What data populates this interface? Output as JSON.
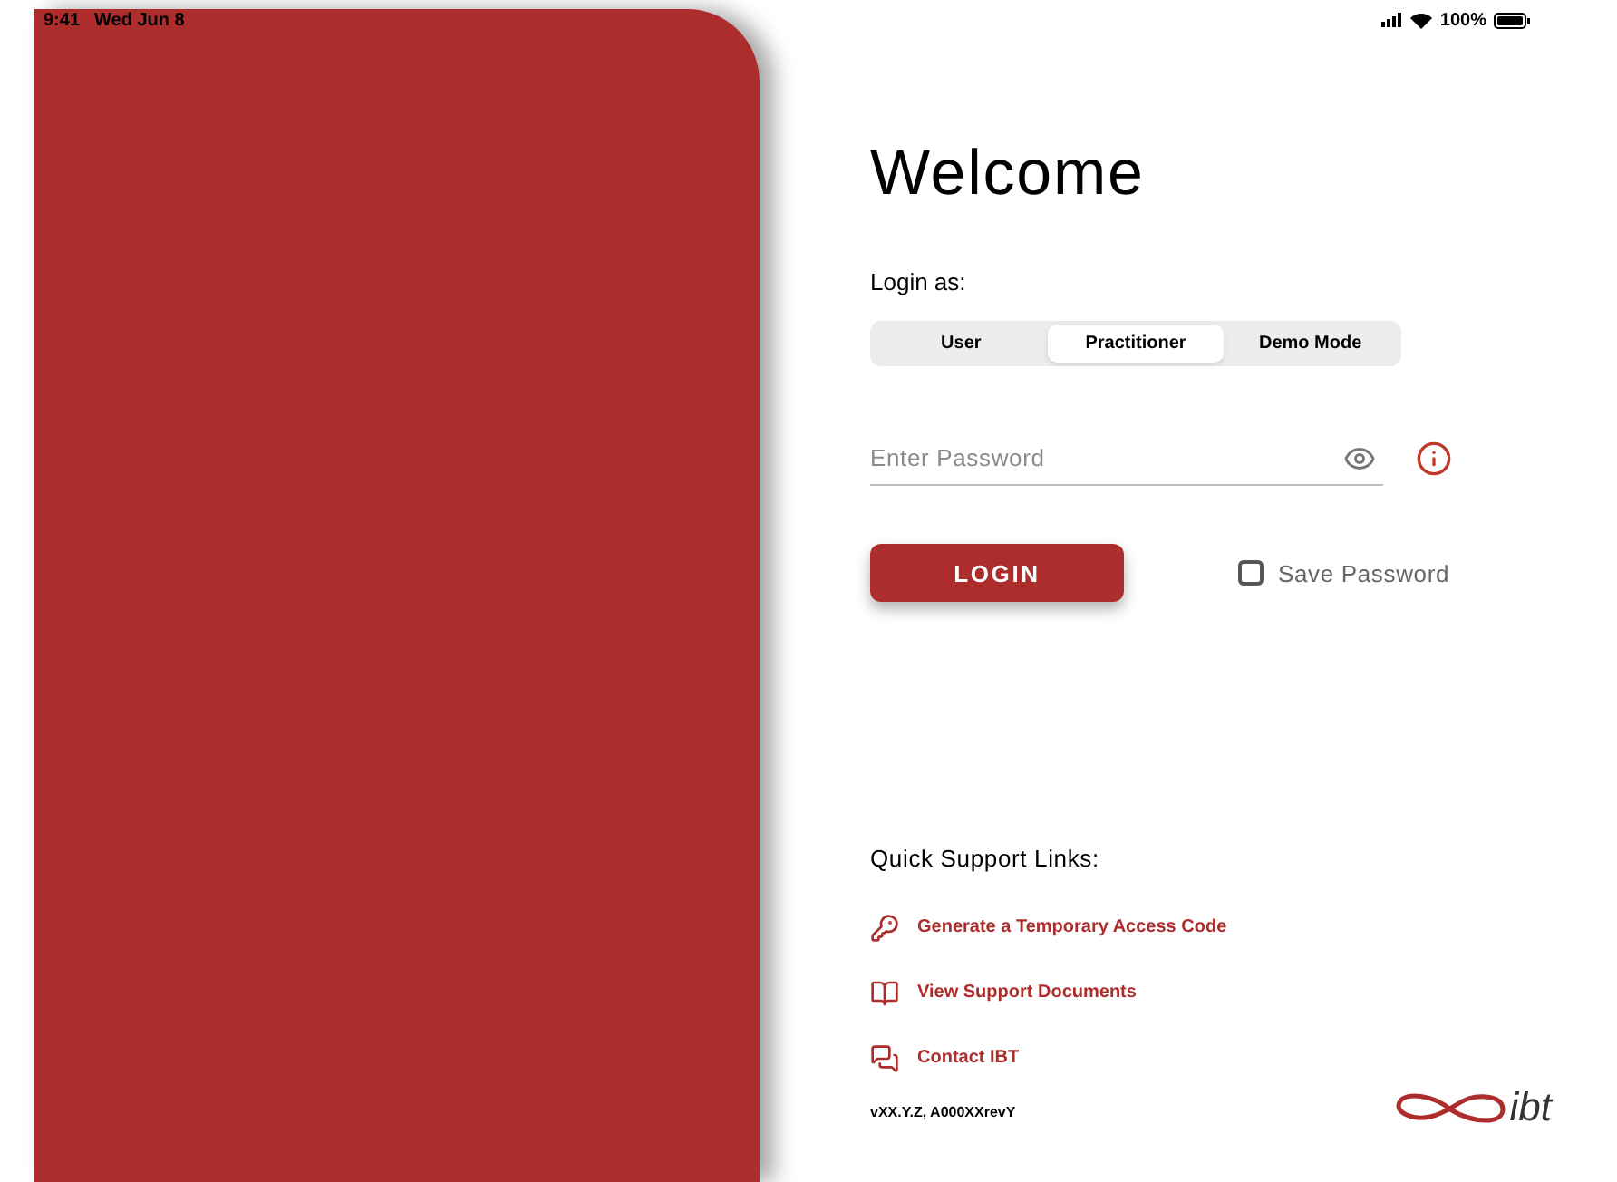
{
  "status_bar": {
    "time": "9:41",
    "date": "Wed Jun 8",
    "battery": "100%"
  },
  "title": "Welcome",
  "login_as": {
    "label": "Login as:",
    "options": [
      {
        "label": "User",
        "selected": false
      },
      {
        "label": "Practitioner",
        "selected": true
      },
      {
        "label": "Demo Mode",
        "selected": false
      }
    ]
  },
  "password": {
    "placeholder": "Enter Password"
  },
  "login_button": "LOGIN",
  "save_password": {
    "label": "Save Password",
    "checked": false
  },
  "support": {
    "heading": "Quick Support Links:",
    "links": [
      {
        "kind": "key",
        "label": "Generate a Temporary Access Code"
      },
      {
        "kind": "book",
        "label": "View Support Documents"
      },
      {
        "kind": "chat",
        "label": "Contact IBT"
      }
    ]
  },
  "version": "vXX.Y.Z, A000XXrevY",
  "logo": "ibt"
}
